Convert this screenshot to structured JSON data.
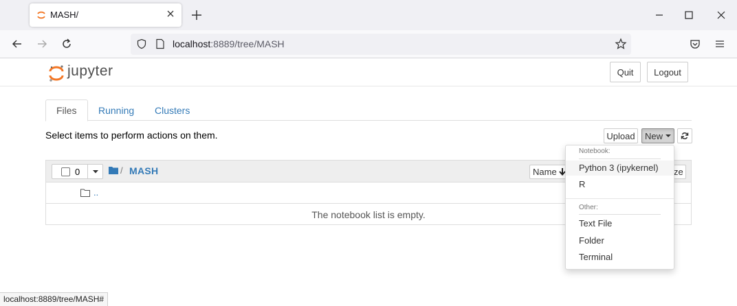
{
  "browser": {
    "tab_title": "MASH/",
    "url_host": "localhost",
    "url_rest": ":8889/tree/MASH",
    "status_url": "localhost:8889/tree/MASH#"
  },
  "jupyter": {
    "logo_text": "jupyter",
    "quit_label": "Quit",
    "logout_label": "Logout",
    "tabs": [
      {
        "label": "Files",
        "active": true
      },
      {
        "label": "Running",
        "active": false
      },
      {
        "label": "Clusters",
        "active": false
      }
    ],
    "hint": "Select items to perform actions on them.",
    "upload_label": "Upload",
    "new_label": "New",
    "selected_count": "0",
    "breadcrumb_sep": "/",
    "breadcrumb_folder": "MASH",
    "sort_label": "Name",
    "size_label_partial": "ze",
    "up_link": "..",
    "empty_message": "The notebook list is empty."
  },
  "new_menu": {
    "notebook_header": "Notebook:",
    "notebook_items": [
      "Python 3 (ipykernel)",
      "R"
    ],
    "other_header": "Other:",
    "other_items": [
      "Text File",
      "Folder",
      "Terminal"
    ]
  },
  "colors": {
    "link": "#337ab7",
    "jupyter_orange": "#f37726",
    "chrome_bg": "#f0f0f4"
  }
}
